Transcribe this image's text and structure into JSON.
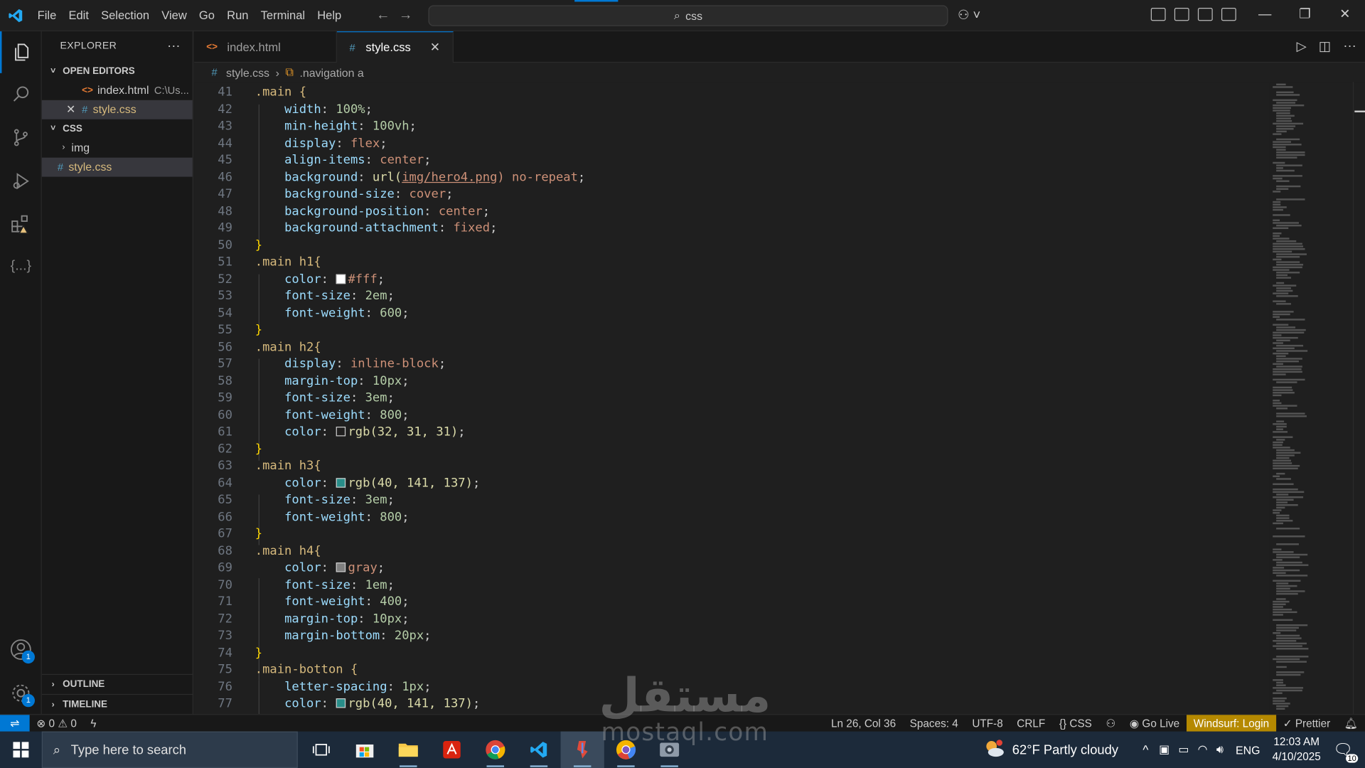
{
  "titlebar": {
    "menu": [
      "File",
      "Edit",
      "Selection",
      "View",
      "Go",
      "Run",
      "Terminal",
      "Help"
    ],
    "search_text": "css"
  },
  "explorer": {
    "title": "EXPLORER",
    "open_editors_label": "OPEN EDITORS",
    "open_editors": [
      {
        "name": "index.html",
        "path": "C:\\Us...",
        "type": "html"
      },
      {
        "name": "style.css",
        "path": "",
        "type": "css"
      }
    ],
    "folder_label": "CSS",
    "tree": [
      {
        "name": "img",
        "type": "folder"
      },
      {
        "name": "style.css",
        "type": "css"
      }
    ],
    "outline_label": "OUTLINE",
    "timeline_label": "TIMELINE"
  },
  "tabs": [
    {
      "label": "index.html",
      "type": "html",
      "active": false
    },
    {
      "label": "style.css",
      "type": "css",
      "active": true
    }
  ],
  "breadcrumb": {
    "file": "style.css",
    "symbol": ".navigation a"
  },
  "code_lines": [
    {
      "n": "41"
    },
    {
      "n": "42"
    },
    {
      "n": "43"
    },
    {
      "n": "44"
    },
    {
      "n": "45"
    },
    {
      "n": "46"
    },
    {
      "n": "47"
    },
    {
      "n": "48"
    },
    {
      "n": "49"
    },
    {
      "n": "50"
    },
    {
      "n": "51"
    },
    {
      "n": "52"
    },
    {
      "n": "53"
    },
    {
      "n": "54"
    },
    {
      "n": "55"
    },
    {
      "n": "56"
    },
    {
      "n": "57"
    },
    {
      "n": "58"
    },
    {
      "n": "59"
    },
    {
      "n": "60"
    },
    {
      "n": "61"
    },
    {
      "n": "62"
    },
    {
      "n": "63"
    },
    {
      "n": "64"
    },
    {
      "n": "65"
    },
    {
      "n": "66"
    },
    {
      "n": "67"
    },
    {
      "n": "68"
    },
    {
      "n": "69"
    },
    {
      "n": "70"
    },
    {
      "n": "71"
    },
    {
      "n": "72"
    },
    {
      "n": "73"
    },
    {
      "n": "74"
    },
    {
      "n": "75"
    },
    {
      "n": "76"
    },
    {
      "n": "77"
    }
  ],
  "code": {
    "l41": ".main {",
    "l42": [
      "width",
      "100%"
    ],
    "l43": [
      "min-height",
      "100vh"
    ],
    "l44": [
      "display",
      "flex"
    ],
    "l45": [
      "align-items",
      "center"
    ],
    "l46": [
      "background",
      "url(",
      "img/hero4.png",
      ") no-repeat"
    ],
    "l47": [
      "background-size",
      "cover"
    ],
    "l48": [
      "background-position",
      "center"
    ],
    "l49": [
      "background-attachment",
      "fixed"
    ],
    "l51": ".main h1{",
    "l52": [
      "color",
      "#fff"
    ],
    "l53": [
      "font-size",
      "2em"
    ],
    "l54": [
      "font-weight",
      "600"
    ],
    "l56": ".main h2{",
    "l57": [
      "display",
      "inline-block"
    ],
    "l58": [
      "margin-top",
      "10px"
    ],
    "l59": [
      "font-size",
      "3em"
    ],
    "l60": [
      "font-weight",
      "800"
    ],
    "l61": [
      "color",
      "rgb(32, 31, 31)"
    ],
    "l63": ".main h3{",
    "l64": [
      "color",
      "rgb(40, 141, 137)"
    ],
    "l65": [
      "font-size",
      "3em"
    ],
    "l66": [
      "font-weight",
      "800"
    ],
    "l68": ".main h4{",
    "l69": [
      "color",
      "gray"
    ],
    "l70": [
      "font-size",
      "1em"
    ],
    "l71": [
      "font-weight",
      "400"
    ],
    "l72": [
      "margin-top",
      "10px"
    ],
    "l73": [
      "margin-bottom",
      "20px"
    ],
    "l75": ".main-botton {",
    "l76": [
      "letter-spacing",
      "1px"
    ],
    "l77": [
      "color",
      "rgb(40, 141, 137)"
    ]
  },
  "swatch_colors": {
    "fff": "#ffffff",
    "dark": "#201f1f",
    "teal": "#288d89",
    "gray": "#808080"
  },
  "statusbar": {
    "errors": "0",
    "warnings": "0",
    "position": "Ln 26, Col 36",
    "spaces": "Spaces: 4",
    "encoding": "UTF-8",
    "eol": "CRLF",
    "language": "CSS",
    "golive": "Go Live",
    "windsurf": "Windsurf: Login",
    "prettier": "Prettier"
  },
  "taskbar": {
    "search_placeholder": "Type here to search",
    "weather": "62°F  Partly cloudy",
    "lang": "ENG",
    "time": "12:03 AM",
    "date": "4/10/2025",
    "notif_count": "10"
  },
  "watermark": {
    "arabic": "مستقل",
    "latin": "mostaql.com"
  },
  "badges": {
    "accounts": "1",
    "settings": "1"
  }
}
